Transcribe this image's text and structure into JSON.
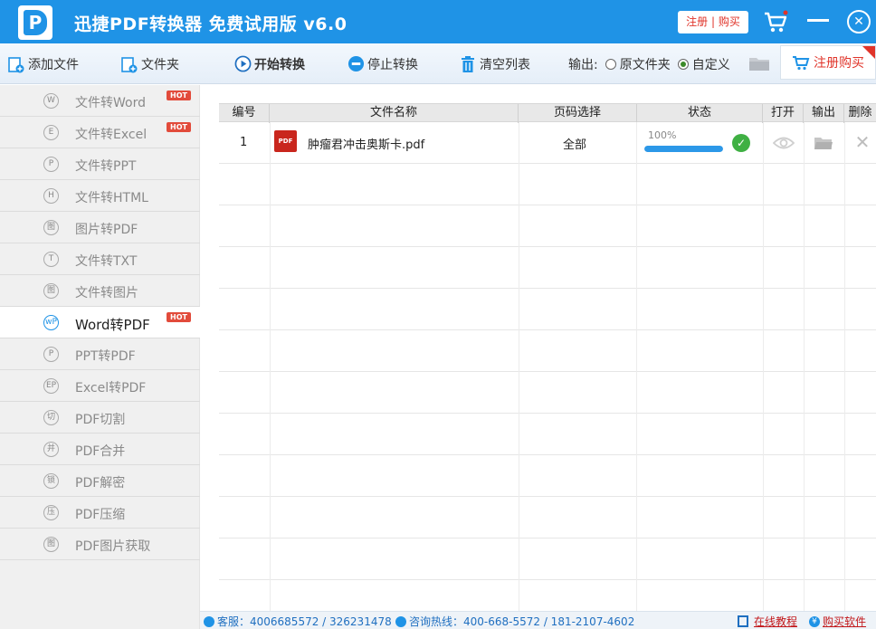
{
  "titlebar": {
    "logo_letter": "P",
    "title": "迅捷PDF转换器 免费试用版 v6.0",
    "register_buy": "注册 | 购买",
    "close_glyph": "✕"
  },
  "toolbar": {
    "add_file": "添加文件",
    "folder": "文件夹",
    "start": "开始转换",
    "stop": "停止转换",
    "clear": "清空列表",
    "output_label": "输出:",
    "output_options": [
      "原文件夹",
      "自定义"
    ],
    "output_selected": "自定义",
    "buy": "注册购买"
  },
  "sidebar": {
    "items": [
      {
        "icon": "W",
        "label": "文件转Word",
        "hot": "HOT"
      },
      {
        "icon": "E",
        "label": "文件转Excel",
        "hot": "HOT"
      },
      {
        "icon": "P",
        "label": "文件转PPT"
      },
      {
        "icon": "H",
        "label": "文件转HTML"
      },
      {
        "icon": "图",
        "label": "图片转PDF"
      },
      {
        "icon": "T",
        "label": "文件转TXT"
      },
      {
        "icon": "图",
        "label": "文件转图片"
      },
      {
        "icon": "wP",
        "label": "Word转PDF",
        "hot": "HOT",
        "active": true
      },
      {
        "icon": "P",
        "label": "PPT转PDF"
      },
      {
        "icon": "EP",
        "label": "Excel转PDF"
      },
      {
        "icon": "切",
        "label": "PDF切割"
      },
      {
        "icon": "并",
        "label": "PDF合并"
      },
      {
        "icon": "锁",
        "label": "PDF解密"
      },
      {
        "icon": "压",
        "label": "PDF压缩"
      },
      {
        "icon": "图",
        "label": "PDF图片获取"
      }
    ]
  },
  "table": {
    "headers": [
      "编号",
      "文件名称",
      "页码选择",
      "状态",
      "打开",
      "输出",
      "删除"
    ],
    "rows": [
      {
        "index": "1",
        "file_type": "PDF",
        "filename": "肿瘤君冲击奥斯卡.pdf",
        "pages": "全部",
        "progress_text": "100%",
        "progress": 1.0,
        "ok_glyph": "✓",
        "delete_glyph": "✕"
      }
    ]
  },
  "statusbar": {
    "support": "客服：4006685572 / 326231478",
    "hotline": "咨询热线：400-668-5572 / 181-2107-4602",
    "tutorial": "在线教程",
    "buy_software": "购买软件",
    "buy_badge": "¥"
  },
  "colors": {
    "brand_blue": "#1f93e6",
    "accent_red": "#e0342a",
    "success_green": "#3fb043"
  }
}
